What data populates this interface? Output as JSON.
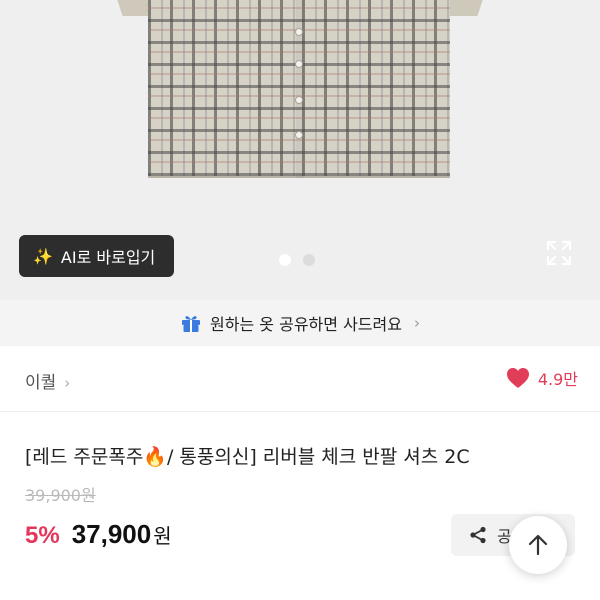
{
  "gallery": {
    "ai_button_label": "AI로 바로입기",
    "slide_count": 2,
    "active_slide": 1
  },
  "share_banner": {
    "text": "원하는 옷 공유하면 사드려요",
    "chevron": "›"
  },
  "seller": {
    "name": "이퀄",
    "chevron": "›",
    "likes": "4.9만"
  },
  "product": {
    "title": "[레드 주문폭주🔥/ 통풍의신] 리버블 체크 반팔 셔츠 2C",
    "original_price": "39,900원",
    "discount": "5%",
    "price": "37,900",
    "currency": "원"
  },
  "actions": {
    "share_label": "공유"
  },
  "colors": {
    "accent": "#e2365a",
    "heart": "#e23d58",
    "dark_button": "#2d2d2d",
    "gift_icon": "#3b7be0"
  }
}
